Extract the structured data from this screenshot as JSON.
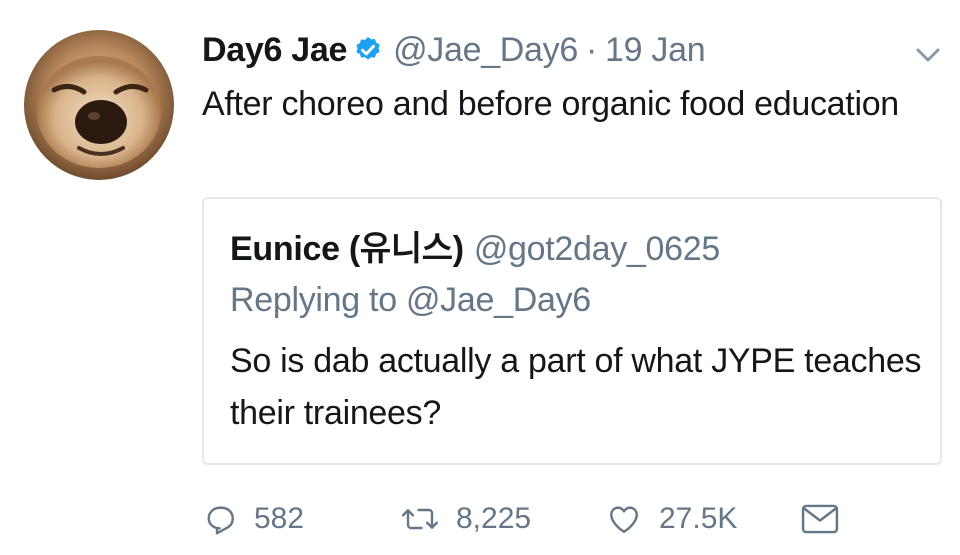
{
  "tweet": {
    "display_name": "Day6 Jae",
    "handle": "@Jae_Day6",
    "separator": "·",
    "date": "19 Jan",
    "text": "After choreo and before organic food education",
    "verified": true
  },
  "quoted_tweet": {
    "display_name": "Eunice (유니스)",
    "handle": "@got2day_0625",
    "replying_to": "Replying to @Jae_Day6",
    "text": "So is dab actually a part of what JYPE teaches their trainees?"
  },
  "actions": {
    "replies": "582",
    "retweets": "8,225",
    "likes": "27.5K"
  },
  "icons": {
    "verified": "verified-badge-icon",
    "menu": "chevron-down-icon",
    "reply": "reply-icon",
    "retweet": "retweet-icon",
    "like": "heart-icon",
    "dm": "envelope-icon"
  },
  "colors": {
    "verified_blue": "#1da1f2",
    "text_primary": "#14171a",
    "text_muted": "#657786",
    "border": "#e1e8ed"
  }
}
